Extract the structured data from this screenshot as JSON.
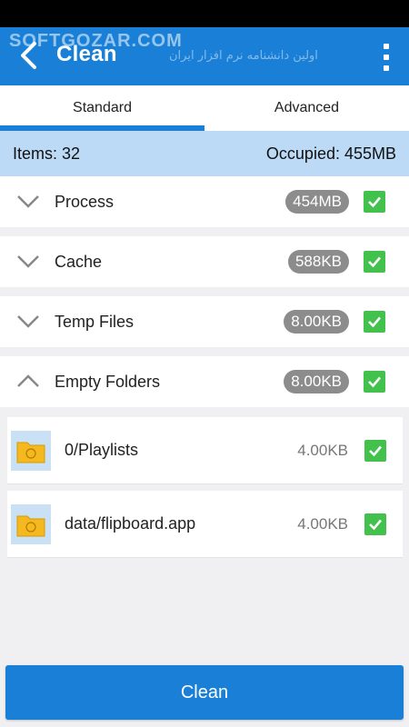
{
  "app_bar": {
    "title": "Clean",
    "watermark": "SOFTGOZAR.COM",
    "watermark_sub": "اولین دانشنامه نرم افزار ایران"
  },
  "tabs": [
    {
      "label": "Standard",
      "active": true
    },
    {
      "label": "Advanced",
      "active": false
    }
  ],
  "summary": {
    "items": "Items: 32",
    "occupied": "Occupied: 455MB"
  },
  "groups": [
    {
      "label": "Process",
      "size": "454MB",
      "expanded": false,
      "checked": true
    },
    {
      "label": "Cache",
      "size": "588KB",
      "expanded": false,
      "checked": true
    },
    {
      "label": "Temp Files",
      "size": "8.00KB",
      "expanded": false,
      "checked": true
    },
    {
      "label": "Empty Folders",
      "size": "8.00KB",
      "expanded": true,
      "checked": true
    }
  ],
  "files": [
    {
      "name": "0/Playlists",
      "size": "4.00KB",
      "checked": true
    },
    {
      "name": "data/flipboard.app",
      "size": "4.00KB",
      "checked": true
    }
  ],
  "footer": {
    "clean_label": "Clean"
  },
  "colors": {
    "primary": "#1a80d7",
    "summary_bg": "#bcdaf6",
    "check": "#43c14d",
    "pill": "#8c8c8c"
  },
  "icons": {
    "back": "chevron-left-icon",
    "more": "more-vert-icon",
    "collapsed": "chevron-down-icon",
    "expanded": "chevron-up-icon",
    "folder": "folder-icon",
    "check": "checkbox-checked-icon"
  }
}
